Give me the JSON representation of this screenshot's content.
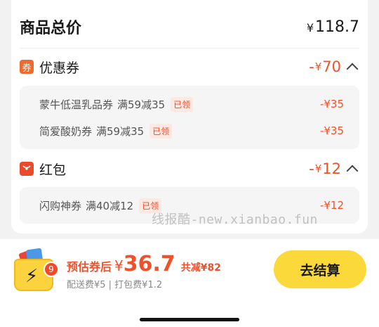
{
  "total": {
    "label": "商品总价",
    "currency": "¥",
    "amount": "118.7"
  },
  "coupons": {
    "icon": "券",
    "title": "优惠券",
    "prefix": "-",
    "currency": "¥",
    "amount": "70",
    "items": [
      {
        "name": "蒙牛低温乳品券",
        "cond": "满59减35",
        "badge": "已领",
        "amount": "-¥35"
      },
      {
        "name": "简爱酸奶券",
        "cond": "满59减35",
        "badge": "已领",
        "amount": "-¥35"
      }
    ]
  },
  "redpacket": {
    "title": "红包",
    "prefix": "-",
    "currency": "¥",
    "amount": "12",
    "items": [
      {
        "name": "闪购神券",
        "cond": "满40减12",
        "badge": "已领",
        "amount": "-¥12"
      }
    ]
  },
  "watermark": "线报酷-new.xianbao.fun",
  "bottom": {
    "cart_count": "9",
    "est_label": "预估券后",
    "est_currency": "¥",
    "est_amount": "36.7",
    "save_text": "共减¥82",
    "fees": "配送费¥5 | 打包费¥1.2",
    "checkout_label": "去结算"
  },
  "colors": {
    "accent": "#f0502a",
    "button": "#fbd93a"
  }
}
